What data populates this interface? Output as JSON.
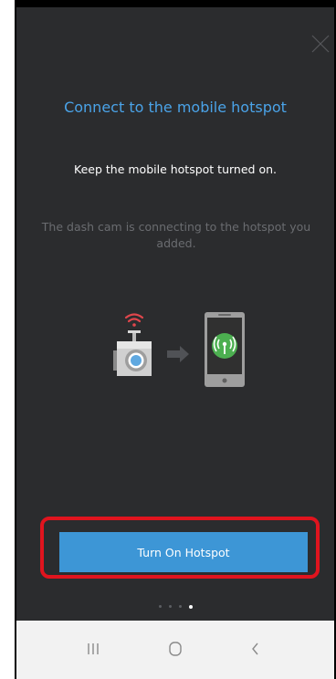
{
  "header": {
    "close_icon": "close-icon"
  },
  "content": {
    "title": "Connect to the mobile hotspot",
    "subtitle": "Keep the mobile hotspot turned on.",
    "description": "The dash cam is connecting to the hotspot you added.",
    "illustration_icons": [
      "wifi-icon",
      "dash-cam-icon",
      "arrow-right-icon",
      "smartphone-icon",
      "hotspot-icon"
    ]
  },
  "cta": {
    "label": "Turn On Hotspot"
  },
  "pagination": {
    "total": 4,
    "current": 4
  },
  "navbar": {
    "icons": [
      "recent-apps-icon",
      "home-icon",
      "back-icon"
    ]
  },
  "colors": {
    "accent": "#4aa3e8",
    "button": "#3d96d6",
    "highlight": "#e0141e",
    "background": "#2b2c2e",
    "hotspot_green": "#4caf50",
    "wifi_red": "#e0464c"
  }
}
